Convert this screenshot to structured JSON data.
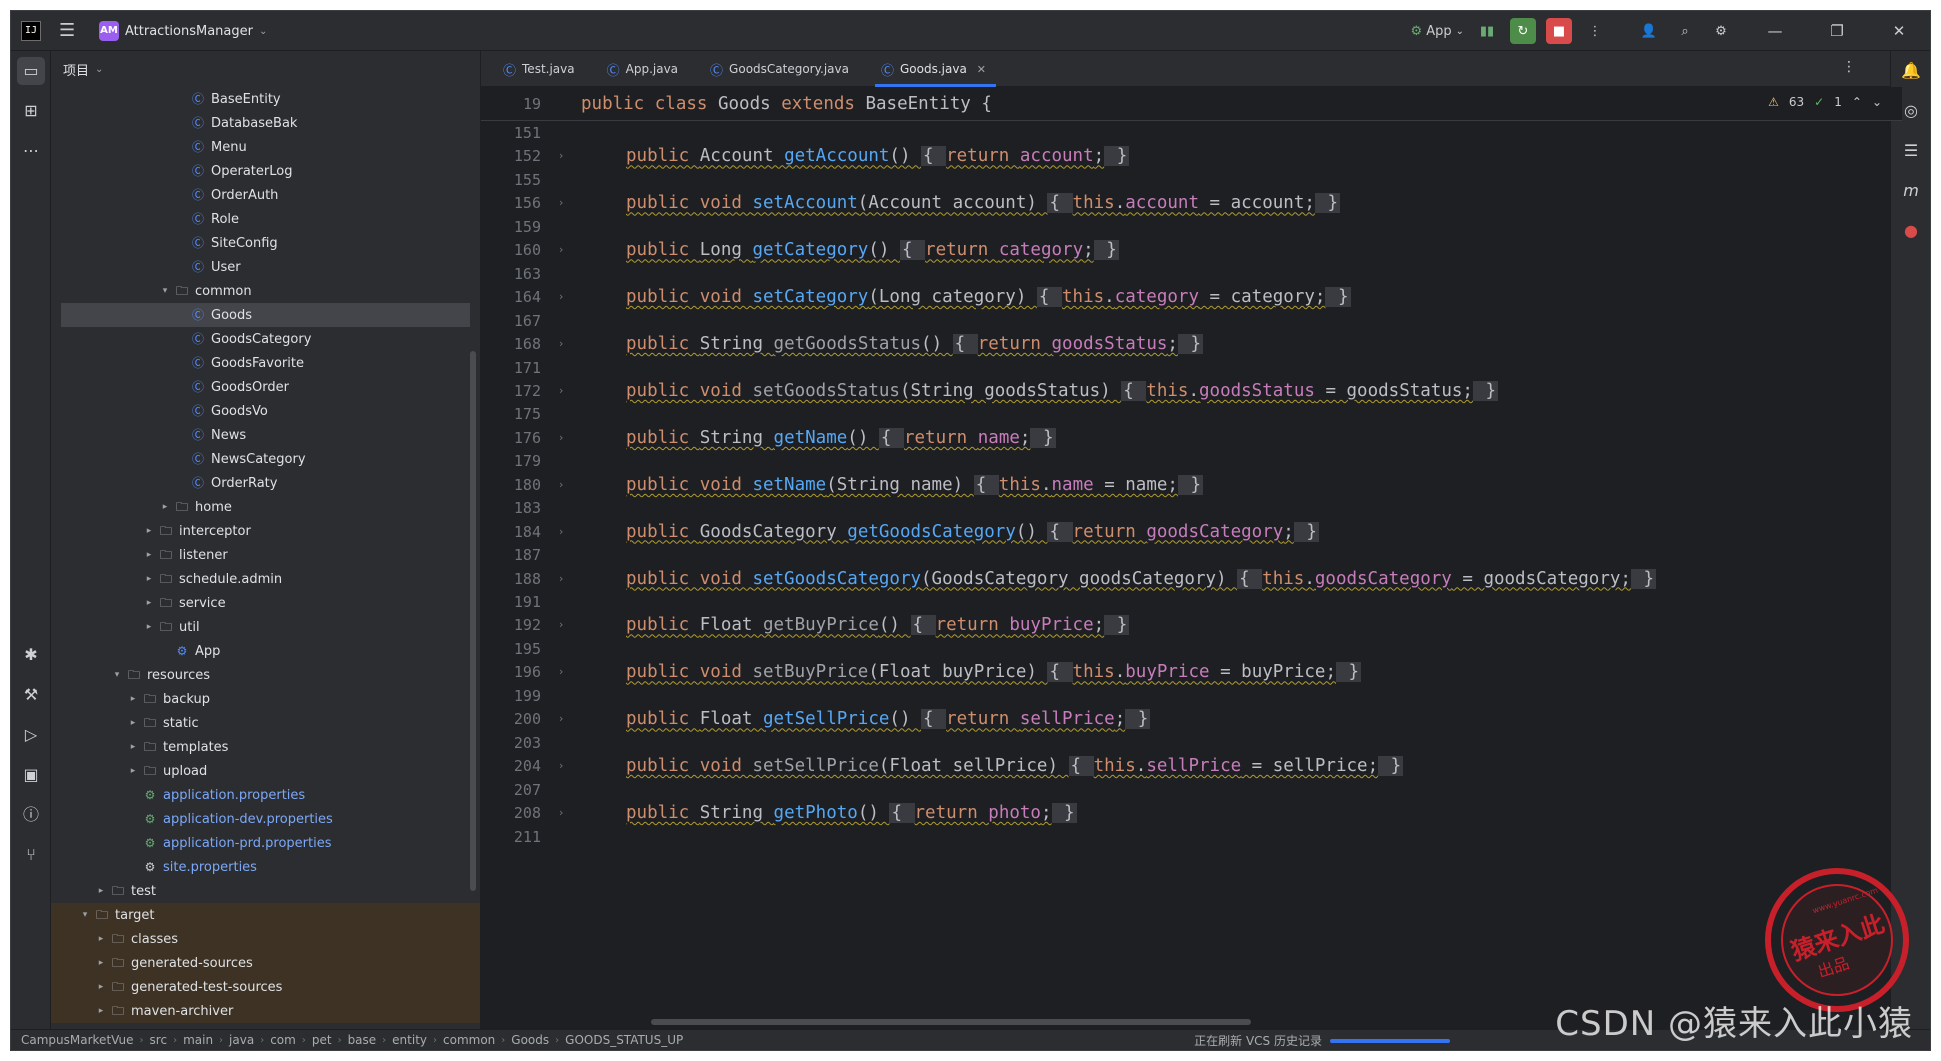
{
  "titlebar": {
    "project_badge": "AM",
    "project_name": "AttractionsManager",
    "run_config": "App"
  },
  "project_panel": {
    "header": "项目",
    "items": [
      {
        "label": "BaseEntity",
        "type": "class",
        "indent": 7
      },
      {
        "label": "DatabaseBak",
        "type": "class",
        "indent": 7
      },
      {
        "label": "Menu",
        "type": "class",
        "indent": 7
      },
      {
        "label": "OperaterLog",
        "type": "class",
        "indent": 7
      },
      {
        "label": "OrderAuth",
        "type": "class",
        "indent": 7
      },
      {
        "label": "Role",
        "type": "class",
        "indent": 7
      },
      {
        "label": "SiteConfig",
        "type": "class",
        "indent": 7
      },
      {
        "label": "User",
        "type": "class",
        "indent": 7
      },
      {
        "label": "common",
        "type": "folder",
        "indent": 6,
        "arrow": "open"
      },
      {
        "label": "Goods",
        "type": "class",
        "indent": 7,
        "selected": true
      },
      {
        "label": "GoodsCategory",
        "type": "class",
        "indent": 7
      },
      {
        "label": "GoodsFavorite",
        "type": "class",
        "indent": 7
      },
      {
        "label": "GoodsOrder",
        "type": "class",
        "indent": 7
      },
      {
        "label": "GoodsVo",
        "type": "class",
        "indent": 7
      },
      {
        "label": "News",
        "type": "class",
        "indent": 7
      },
      {
        "label": "NewsCategory",
        "type": "class",
        "indent": 7
      },
      {
        "label": "OrderRaty",
        "type": "class",
        "indent": 7
      },
      {
        "label": "home",
        "type": "folder",
        "indent": 6,
        "arrow": "closed"
      },
      {
        "label": "interceptor",
        "type": "folder",
        "indent": 5,
        "arrow": "closed"
      },
      {
        "label": "listener",
        "type": "folder",
        "indent": 5,
        "arrow": "closed"
      },
      {
        "label": "schedule.admin",
        "type": "folder",
        "indent": 5,
        "arrow": "closed"
      },
      {
        "label": "service",
        "type": "folder",
        "indent": 5,
        "arrow": "closed"
      },
      {
        "label": "util",
        "type": "folder",
        "indent": 5,
        "arrow": "closed"
      },
      {
        "label": "App",
        "type": "app",
        "indent": 6
      },
      {
        "label": "resources",
        "type": "folder",
        "indent": 3,
        "arrow": "open"
      },
      {
        "label": "backup",
        "type": "folder",
        "indent": 4,
        "arrow": "closed"
      },
      {
        "label": "static",
        "type": "folder",
        "indent": 4,
        "arrow": "closed"
      },
      {
        "label": "templates",
        "type": "folder",
        "indent": 4,
        "arrow": "closed"
      },
      {
        "label": "upload",
        "type": "folder",
        "indent": 4,
        "arrow": "closed"
      },
      {
        "label": "application.properties",
        "type": "props",
        "indent": 4
      },
      {
        "label": "application-dev.properties",
        "type": "props",
        "indent": 4
      },
      {
        "label": "application-prd.properties",
        "type": "props",
        "indent": 4
      },
      {
        "label": "site.properties",
        "type": "settings",
        "indent": 4
      },
      {
        "label": "test",
        "type": "folder",
        "indent": 2,
        "arrow": "closed"
      },
      {
        "label": "target",
        "type": "folder",
        "indent": 1,
        "arrow": "open",
        "target": true
      },
      {
        "label": "classes",
        "type": "folder",
        "indent": 2,
        "arrow": "closed",
        "target": true
      },
      {
        "label": "generated-sources",
        "type": "folder",
        "indent": 2,
        "arrow": "closed",
        "target": true
      },
      {
        "label": "generated-test-sources",
        "type": "folder",
        "indent": 2,
        "arrow": "closed",
        "target": true
      },
      {
        "label": "maven-archiver",
        "type": "folder",
        "indent": 2,
        "arrow": "closed",
        "target": true
      }
    ]
  },
  "tabs": [
    {
      "label": "Test.java",
      "active": false
    },
    {
      "label": "App.java",
      "active": false
    },
    {
      "label": "GoodsCategory.java",
      "active": false
    },
    {
      "label": "Goods.java",
      "active": true
    }
  ],
  "inspections": {
    "warnings": "63",
    "ok": "1"
  },
  "sticky_line": {
    "num": "19",
    "text": "public class Goods extends BaseEntity {"
  },
  "code_lines": [
    {
      "num": "151",
      "parts": []
    },
    {
      "num": "152",
      "fold": true,
      "parts": [
        [
          "kw",
          "public "
        ],
        [
          "plain",
          "Account "
        ],
        [
          "fn",
          "getAccount"
        ],
        [
          "plain",
          "() "
        ],
        [
          "brace",
          "{ "
        ],
        [
          "kw",
          "return "
        ],
        [
          "fld",
          "account"
        ],
        [
          "plain",
          ";"
        ],
        [
          "brace",
          " }"
        ]
      ]
    },
    {
      "num": "155",
      "parts": []
    },
    {
      "num": "156",
      "fold": true,
      "parts": [
        [
          "kw",
          "public void "
        ],
        [
          "fn",
          "setAccount"
        ],
        [
          "plain",
          "(Account account) "
        ],
        [
          "brace",
          "{ "
        ],
        [
          "kw",
          "this"
        ],
        [
          "plain",
          "."
        ],
        [
          "fld",
          "account"
        ],
        [
          "plain",
          " = account;"
        ],
        [
          "brace",
          " }"
        ]
      ]
    },
    {
      "num": "159",
      "parts": []
    },
    {
      "num": "160",
      "fold": true,
      "parts": [
        [
          "kw",
          "public "
        ],
        [
          "plain",
          "Long "
        ],
        [
          "fn",
          "getCategory"
        ],
        [
          "plain",
          "() "
        ],
        [
          "brace",
          "{ "
        ],
        [
          "kw",
          "return "
        ],
        [
          "fld",
          "category"
        ],
        [
          "plain",
          ";"
        ],
        [
          "brace",
          " }"
        ]
      ]
    },
    {
      "num": "163",
      "parts": []
    },
    {
      "num": "164",
      "fold": true,
      "parts": [
        [
          "kw",
          "public void "
        ],
        [
          "fn",
          "setCategory"
        ],
        [
          "plain",
          "(Long category) "
        ],
        [
          "brace",
          "{ "
        ],
        [
          "kw",
          "this"
        ],
        [
          "plain",
          "."
        ],
        [
          "fld",
          "category"
        ],
        [
          "plain",
          " = category;"
        ],
        [
          "brace",
          " }"
        ]
      ]
    },
    {
      "num": "167",
      "parts": []
    },
    {
      "num": "168",
      "fold": true,
      "parts": [
        [
          "kw",
          "public "
        ],
        [
          "plain",
          "String "
        ],
        [
          "fngray",
          "getGoodsStatus"
        ],
        [
          "plain",
          "() "
        ],
        [
          "brace",
          "{ "
        ],
        [
          "kw",
          "return "
        ],
        [
          "fld",
          "goodsStatus"
        ],
        [
          "plain",
          ";"
        ],
        [
          "brace",
          " }"
        ]
      ]
    },
    {
      "num": "171",
      "parts": []
    },
    {
      "num": "172",
      "fold": true,
      "parts": [
        [
          "kw",
          "public void "
        ],
        [
          "fngray",
          "setGoodsStatus"
        ],
        [
          "plain",
          "(String goodsStatus) "
        ],
        [
          "brace",
          "{ "
        ],
        [
          "kw",
          "this"
        ],
        [
          "plain",
          "."
        ],
        [
          "fld",
          "goodsStatus"
        ],
        [
          "plain",
          " = goodsStatus;"
        ],
        [
          "brace",
          " }"
        ]
      ]
    },
    {
      "num": "175",
      "parts": []
    },
    {
      "num": "176",
      "fold": true,
      "parts": [
        [
          "kw",
          "public "
        ],
        [
          "plain",
          "String "
        ],
        [
          "fn",
          "getName"
        ],
        [
          "plain",
          "() "
        ],
        [
          "brace",
          "{ "
        ],
        [
          "kw",
          "return "
        ],
        [
          "fld",
          "name"
        ],
        [
          "plain",
          ";"
        ],
        [
          "brace",
          " }"
        ]
      ]
    },
    {
      "num": "179",
      "parts": []
    },
    {
      "num": "180",
      "fold": true,
      "parts": [
        [
          "kw",
          "public void "
        ],
        [
          "fn",
          "setName"
        ],
        [
          "plain",
          "(String name) "
        ],
        [
          "brace",
          "{ "
        ],
        [
          "kw",
          "this"
        ],
        [
          "plain",
          "."
        ],
        [
          "fld",
          "name"
        ],
        [
          "plain",
          " = name;"
        ],
        [
          "brace",
          " }"
        ]
      ]
    },
    {
      "num": "183",
      "parts": []
    },
    {
      "num": "184",
      "fold": true,
      "parts": [
        [
          "kw",
          "public "
        ],
        [
          "plain",
          "GoodsCategory "
        ],
        [
          "fn",
          "getGoodsCategory"
        ],
        [
          "plain",
          "() "
        ],
        [
          "brace",
          "{ "
        ],
        [
          "kw",
          "return "
        ],
        [
          "fld",
          "goodsCategory"
        ],
        [
          "plain",
          ";"
        ],
        [
          "brace",
          " }"
        ]
      ]
    },
    {
      "num": "187",
      "parts": []
    },
    {
      "num": "188",
      "fold": true,
      "parts": [
        [
          "kw",
          "public void "
        ],
        [
          "fn",
          "setGoodsCategory"
        ],
        [
          "plain",
          "(GoodsCategory goodsCategory) "
        ],
        [
          "brace",
          "{ "
        ],
        [
          "kw",
          "this"
        ],
        [
          "plain",
          "."
        ],
        [
          "fld",
          "goodsCategory"
        ],
        [
          "plain",
          " = goodsCategory;"
        ],
        [
          "brace",
          " }"
        ]
      ]
    },
    {
      "num": "191",
      "parts": []
    },
    {
      "num": "192",
      "fold": true,
      "parts": [
        [
          "kw",
          "public "
        ],
        [
          "plain",
          "Float "
        ],
        [
          "fngray",
          "getBuyPrice"
        ],
        [
          "plain",
          "() "
        ],
        [
          "brace",
          "{ "
        ],
        [
          "kw",
          "return "
        ],
        [
          "fld",
          "buyPrice"
        ],
        [
          "plain",
          ";"
        ],
        [
          "brace",
          " }"
        ]
      ]
    },
    {
      "num": "195",
      "parts": []
    },
    {
      "num": "196",
      "fold": true,
      "parts": [
        [
          "kw",
          "public void "
        ],
        [
          "fngray",
          "setBuyPrice"
        ],
        [
          "plain",
          "(Float buyPrice) "
        ],
        [
          "brace",
          "{ "
        ],
        [
          "kw",
          "this"
        ],
        [
          "plain",
          "."
        ],
        [
          "fld",
          "buyPrice"
        ],
        [
          "plain",
          " = buyPrice;"
        ],
        [
          "brace",
          " }"
        ]
      ]
    },
    {
      "num": "199",
      "parts": []
    },
    {
      "num": "200",
      "fold": true,
      "parts": [
        [
          "kw",
          "public "
        ],
        [
          "plain",
          "Float "
        ],
        [
          "fn",
          "getSellPrice"
        ],
        [
          "plain",
          "() "
        ],
        [
          "brace",
          "{ "
        ],
        [
          "kw",
          "return "
        ],
        [
          "fld",
          "sellPrice"
        ],
        [
          "plain",
          ";"
        ],
        [
          "brace",
          " }"
        ]
      ]
    },
    {
      "num": "203",
      "parts": []
    },
    {
      "num": "204",
      "fold": true,
      "parts": [
        [
          "kw",
          "public void "
        ],
        [
          "fngray",
          "setSellPrice"
        ],
        [
          "plain",
          "(Float sellPrice) "
        ],
        [
          "brace",
          "{ "
        ],
        [
          "kw",
          "this"
        ],
        [
          "plain",
          "."
        ],
        [
          "fld",
          "sellPrice"
        ],
        [
          "plain",
          " = sellPrice;"
        ],
        [
          "brace",
          " }"
        ]
      ]
    },
    {
      "num": "207",
      "parts": []
    },
    {
      "num": "208",
      "fold": true,
      "parts": [
        [
          "kw",
          "public "
        ],
        [
          "plain",
          "String "
        ],
        [
          "fn",
          "getPhoto"
        ],
        [
          "plain",
          "() "
        ],
        [
          "brace",
          "{ "
        ],
        [
          "kw",
          "return "
        ],
        [
          "fld",
          "photo"
        ],
        [
          "plain",
          ";"
        ],
        [
          "brace",
          " }"
        ]
      ]
    },
    {
      "num": "211",
      "parts": []
    }
  ],
  "statusbar": {
    "breadcrumbs": [
      "CampusMarketVue",
      "src",
      "main",
      "java",
      "com",
      "pet",
      "base",
      "entity",
      "common",
      "Goods",
      "GOODS_STATUS_UP"
    ],
    "task": "正在刷新 VCS 历史记录"
  },
  "watermark": {
    "text": "CSDN @猿来入此小猿",
    "seal_main": "猿来入此",
    "seal_sub": "出品",
    "seal_url": "www.yuanrc.com"
  },
  "colors": {
    "keyword": "#cf8e6d",
    "method": "#56a8f5",
    "field": "#c77dbb",
    "text": "#bcbec4",
    "accent": "#3574f0"
  }
}
